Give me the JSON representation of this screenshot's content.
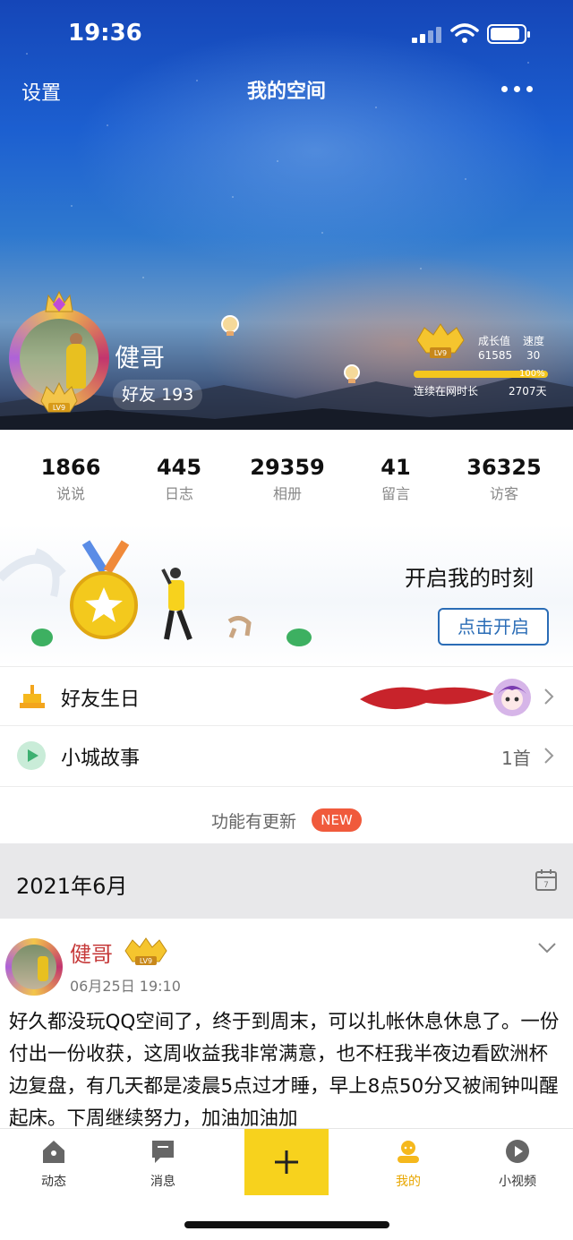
{
  "status_bar": {
    "time": "19:36"
  },
  "nav": {
    "settings_label": "设置",
    "title": "我的空间"
  },
  "profile": {
    "name": "健哥",
    "friends_label": "好友",
    "friends_count": "193",
    "level_badge": "LV9"
  },
  "growth": {
    "growth_label": "成长值",
    "speed_label": "速度",
    "growth_value": "61585",
    "speed_value": "30",
    "progress_percent": "100%",
    "progress_fraction": 1.0,
    "online_label": "连续在网时长",
    "online_value": "2707天"
  },
  "counts": [
    {
      "num": "1866",
      "label": "说说"
    },
    {
      "num": "445",
      "label": "日志"
    },
    {
      "num": "29359",
      "label": "相册"
    },
    {
      "num": "41",
      "label": "留言"
    },
    {
      "num": "36325",
      "label": "访客"
    }
  ],
  "banner": {
    "title": "开启我的时刻",
    "button": "点击开启"
  },
  "rows": {
    "birthday": {
      "label": "好友生日"
    },
    "story": {
      "label": "小城故事",
      "value": "1首"
    }
  },
  "update": {
    "text": "功能有更新",
    "badge": "NEW"
  },
  "date_band": {
    "date": "2021年6月"
  },
  "post": {
    "author": "健哥",
    "level_badge": "LV9",
    "time": "06月25日 19:10",
    "body": "好久都没玩QQ空间了，终于到周末，可以扎帐休息休息了。一份付出一份收获，这周收益我非常满意，也不枉我半夜边看欧洲杯边复盘，有几天都是凌晨5点过才睡，早上8点50分又被闹钟叫醒起床。下周继续努力，加油加油加"
  },
  "tabbar": [
    {
      "label": "动态",
      "icon": "home-icon"
    },
    {
      "label": "消息",
      "icon": "message-icon"
    },
    {
      "label": "",
      "icon": "plus-icon"
    },
    {
      "label": "我的",
      "icon": "profile-icon"
    },
    {
      "label": "小视频",
      "icon": "video-icon"
    }
  ],
  "colors": {
    "accent_yellow": "#f7d21d",
    "author_red": "#c63b3b",
    "new_badge": "#f05a3c",
    "button_blue": "#2a6cb6"
  }
}
